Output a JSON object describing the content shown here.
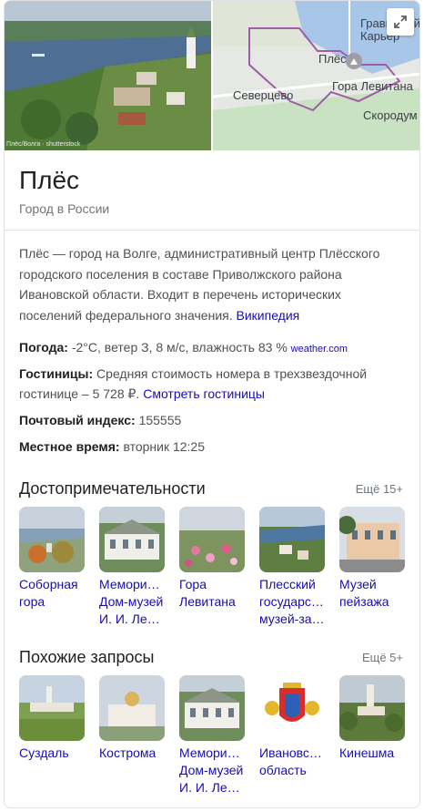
{
  "title": "Плёс",
  "subtitle": "Город в России",
  "photo_credit": "Плёс/Волга · shutterstock",
  "map": {
    "labels": [
      "Гравийный Карьер",
      "Плёс",
      "Гора Левитана",
      "Северцево",
      "Скородум"
    ]
  },
  "description": {
    "text": "Плёс — город на Волге, административный центр Плёсского городского поселения в составе Приволжского района Ивановской области. Входит в перечень исторических поселений федерального значения.",
    "link": "Википедия"
  },
  "facts": {
    "weather_label": "Погода:",
    "weather_value": "-2°C, ветер З, 8 м/с, влажность 83 %",
    "weather_link": "weather.com",
    "hotels_label": "Гостиницы:",
    "hotels_value": "Средняя стоимость номера в трехзвездочной гостинице – 5 728 ₽.",
    "hotels_link": "Смотреть гостиницы",
    "postal_label": "Почтовый индекс:",
    "postal_value": "155555",
    "time_label": "Местное время:",
    "time_value": "вторник 12:25"
  },
  "sights": {
    "title": "Достопримечательности",
    "more": "Ещё 15+",
    "items": [
      {
        "label": "Соборная гора"
      },
      {
        "label": "Мемори… Дом-музей И. И. Ле…"
      },
      {
        "label": "Гора Левитана"
      },
      {
        "label": "Плесский государс… музей-за…"
      },
      {
        "label": "Музей пейзажа"
      }
    ]
  },
  "related": {
    "title": "Похожие запросы",
    "more": "Ещё 5+",
    "items": [
      {
        "label": "Суздаль"
      },
      {
        "label": "Кострома"
      },
      {
        "label": "Мемори… Дом-музей И. И. Ле…"
      },
      {
        "label": "Ивановс… область"
      },
      {
        "label": "Кинешма"
      }
    ]
  },
  "colors": {
    "link": "#1a0dab",
    "text": "#202124",
    "muted": "#70757a",
    "map_boundary": "#a05ca8"
  }
}
